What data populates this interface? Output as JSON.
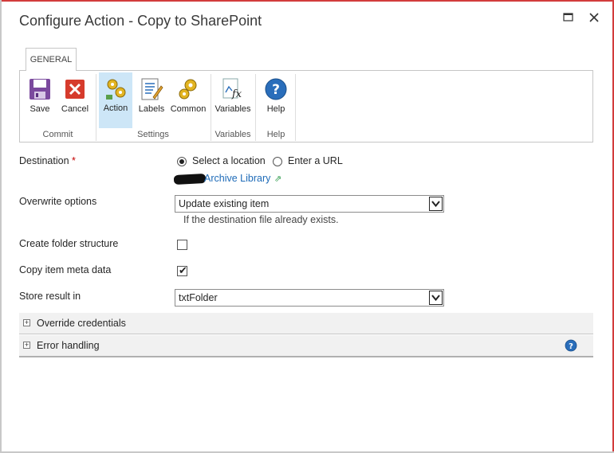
{
  "dialog": {
    "title": "Configure Action - Copy to SharePoint"
  },
  "ribbon": {
    "tab": "GENERAL",
    "groups": {
      "commit": "Commit",
      "settings": "Settings",
      "variables": "Variables",
      "help": "Help"
    },
    "buttons": {
      "save": "Save",
      "cancel": "Cancel",
      "action": "Action",
      "labels": "Labels",
      "common": "Common",
      "variables": "Variables",
      "help": "Help"
    }
  },
  "form": {
    "destination": {
      "label": "Destination",
      "required_mark": "*",
      "option_select": "Select a location",
      "option_url": "Enter a URL",
      "link": "Archive Library"
    },
    "overwrite": {
      "label": "Overwrite options",
      "value": "Update existing item",
      "hint": "If the destination file already exists."
    },
    "create_folder": {
      "label": "Create folder structure",
      "checked": false
    },
    "copy_meta": {
      "label": "Copy item meta data",
      "checked": true
    },
    "store_result": {
      "label": "Store result in",
      "value": "txtFolder"
    }
  },
  "sections": {
    "override": "Override credentials",
    "error": "Error handling"
  },
  "colors": {
    "link": "#1e6bb8",
    "active_button": "#cde6f7",
    "required": "#c40000",
    "help_icon": "#2a6ebb"
  }
}
